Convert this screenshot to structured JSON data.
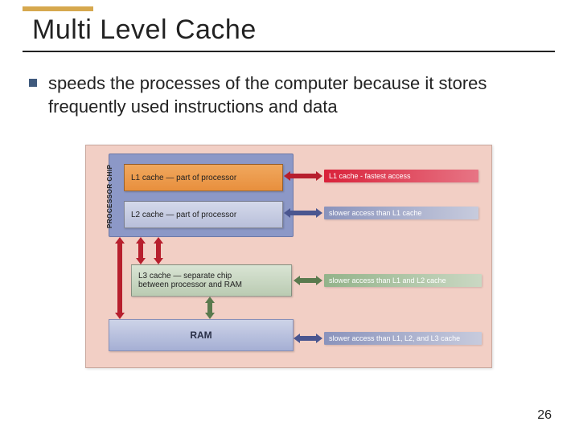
{
  "slide": {
    "title": "Multi Level Cache",
    "bullet": "speeds the processes of the computer because it stores frequently used instructions and data",
    "page_number": "26"
  },
  "diagram": {
    "processor_label": "PROCESSOR CHIP",
    "l1_label": "L1 cache — part of processor",
    "l2_label": "L2 cache — part of processor",
    "l3_label_line1": "L3 cache — separate chip",
    "l3_label_line2": "between processor and RAM",
    "ram_label": "RAM",
    "speed1": "L1 cache - fastest access",
    "speed2": "slower access than L1 cache",
    "speed3": "slower access than L1 and L2 cache",
    "speed4": "slower access than L1, L2, and L3 cache"
  }
}
